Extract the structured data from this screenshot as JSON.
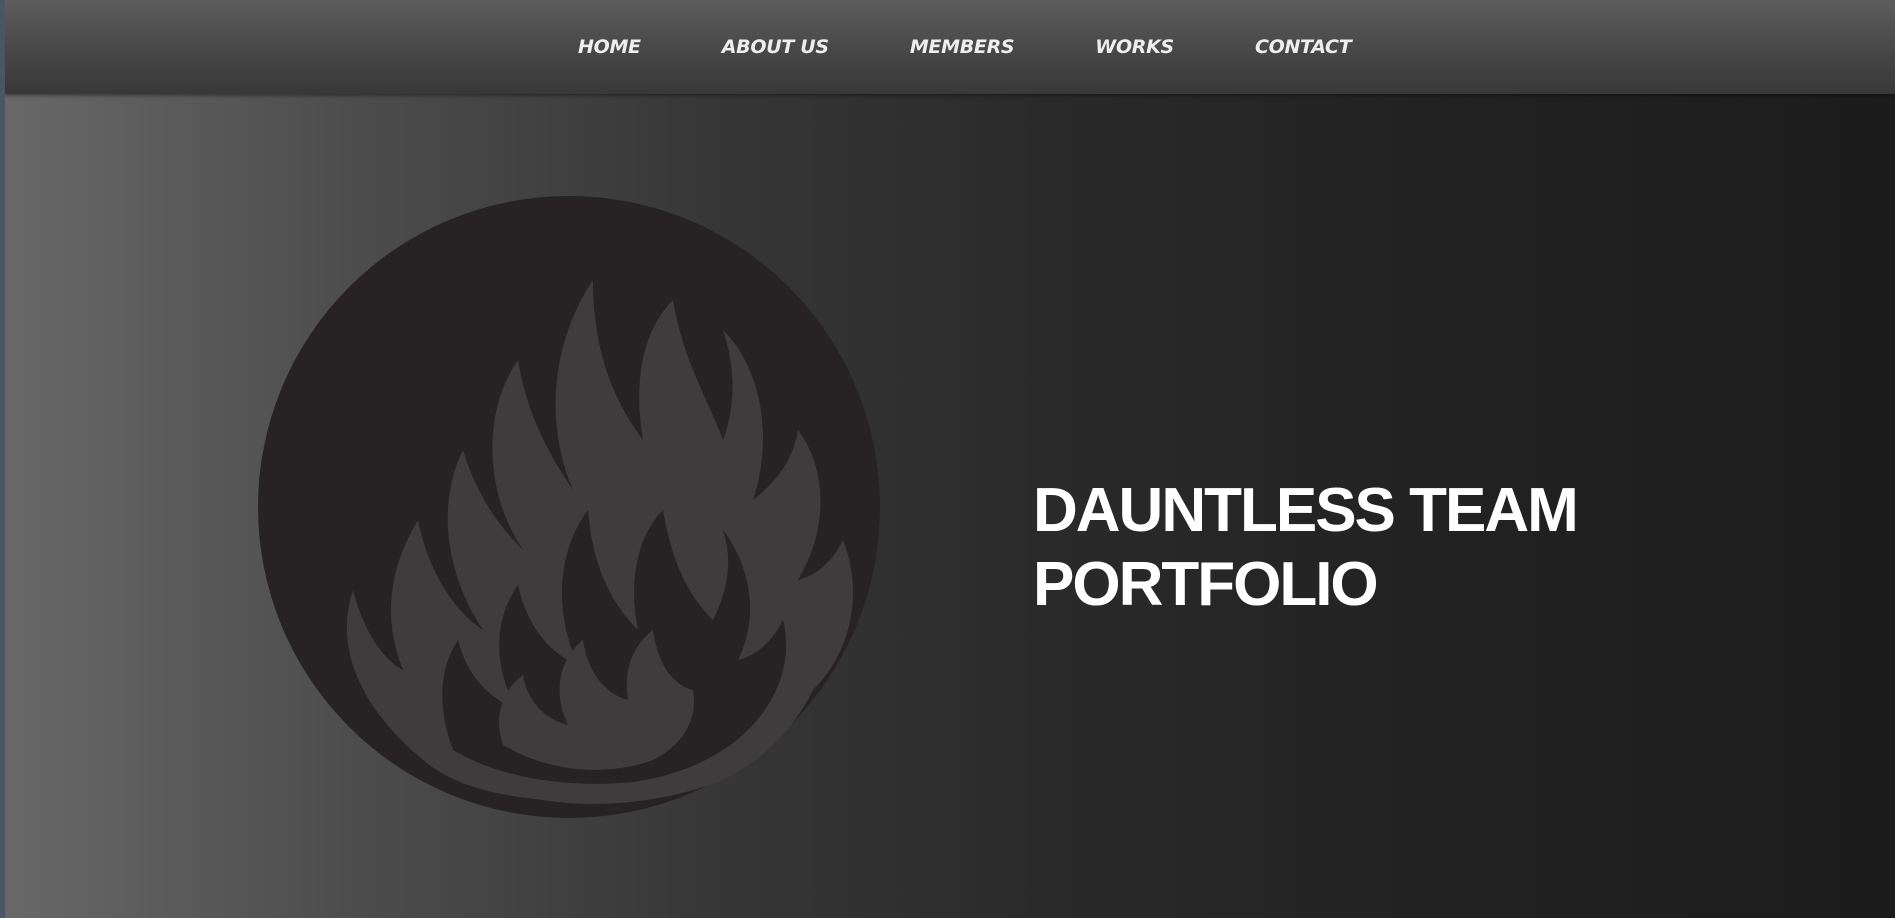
{
  "nav": {
    "items": [
      {
        "label": "HOME"
      },
      {
        "label": "ABOUT US"
      },
      {
        "label": "MEMBERS"
      },
      {
        "label": "WORKS"
      },
      {
        "label": "CONTACT"
      }
    ]
  },
  "hero": {
    "title_line1": "DAUNTLESS TEAM",
    "title_line2": "PORTFOLIO",
    "logo_icon": "flame-in-circle-icon"
  },
  "colors": {
    "text": "#ffffff",
    "nav_text": "#eeeeee",
    "emblem_circle": "#272224",
    "flame": "#3e3c3d"
  }
}
